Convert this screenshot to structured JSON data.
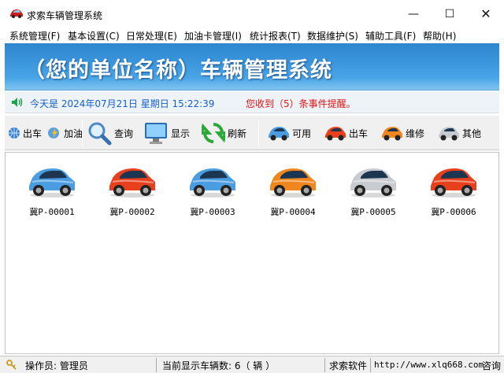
{
  "window": {
    "title": "求索车辆管理系统",
    "minimize_glyph": "—",
    "maximize_glyph": "☐",
    "close_glyph": "✕"
  },
  "menu": [
    "系统管理(F)",
    "基本设置(C)",
    "日常处理(E)",
    "加油卡管理(I)",
    "统计报表(T)",
    "数据维护(S)",
    "辅助工具(F)",
    "帮助(H)"
  ],
  "banner": {
    "title": "（您的单位名称）车辆管理系统"
  },
  "status": {
    "date_text": "今天是  2024年07月21日  星期日  15:22:39",
    "alert_text": "您收到（5）条事件提醒。"
  },
  "toolbar": [
    {
      "label": "出车",
      "icon": "car-out-icon"
    },
    {
      "label": "加油",
      "icon": "fuel-icon"
    },
    {
      "label": "查询",
      "icon": "magnifier-icon"
    },
    {
      "label": "显示",
      "icon": "monitor-icon"
    },
    {
      "label": "刷新",
      "icon": "refresh-icon"
    },
    {
      "label": "可用",
      "icon": "car-blue-icon"
    },
    {
      "label": "出车",
      "icon": "car-red-icon"
    },
    {
      "label": "维修",
      "icon": "car-orange-icon"
    },
    {
      "label": "其他",
      "icon": "car-silver-icon"
    }
  ],
  "cars": [
    {
      "plate": "冀P-00001",
      "color": "#4a9de0",
      "state": "可用"
    },
    {
      "plate": "冀P-00002",
      "color": "#e8401c",
      "state": "出车"
    },
    {
      "plate": "冀P-00003",
      "color": "#4a9de0",
      "state": "可用"
    },
    {
      "plate": "冀P-00004",
      "color": "#f0861e",
      "state": "维修"
    },
    {
      "plate": "冀P-00005",
      "color": "#c8ccd0",
      "state": "其他"
    },
    {
      "plate": "冀P-00006",
      "color": "#e8401c",
      "state": "出车"
    }
  ],
  "statusbar": {
    "operator": "操作员: 管理员",
    "vehicle_count": "当前显示车辆数: 6（ 辆 ）",
    "company": "求索软件",
    "url": "http://www.xlq668.com",
    "consult": "咨询"
  }
}
